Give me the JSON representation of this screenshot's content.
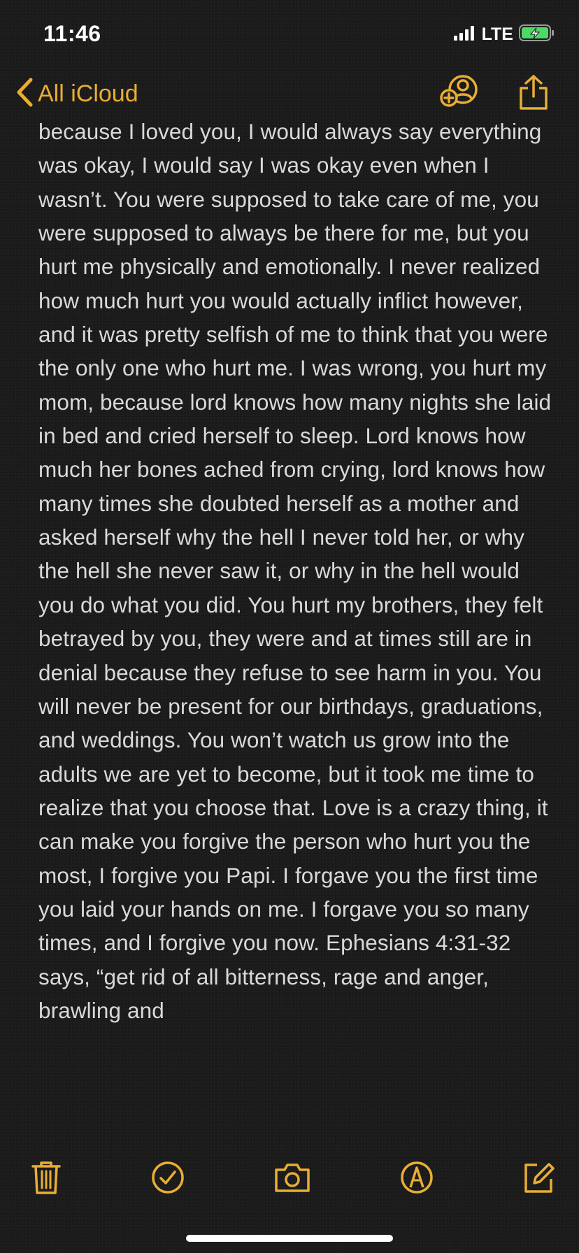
{
  "status_bar": {
    "time": "11:46",
    "carrier": "LTE",
    "icons": [
      "signal-bars-icon",
      "battery-charging-icon"
    ]
  },
  "nav": {
    "back_label": "All iCloud",
    "icons": [
      "chevron-left-icon",
      "add-people-icon",
      "share-icon"
    ]
  },
  "note": {
    "text": "because I loved you, I would always say everything was okay, I would say I was okay even when I wasn’t. You were supposed to take care of me, you were supposed to always be there for me, but you hurt me physically and emotionally. I never realized how much hurt you would actually inflict however, and it was pretty selfish of me to think that you were the only one who hurt me. I was wrong, you hurt my mom, because lord knows how many nights she laid in bed and cried herself to sleep. Lord knows how much her bones ached from crying, lord knows how many times she doubted herself as a mother and asked herself why the hell I never told her, or why the hell she never saw it, or why in the hell would you do what you did. You hurt my brothers, they felt betrayed by you, they were and at times still are in denial because they refuse to see harm in you. You will never be present for our birthdays, graduations, and weddings. You won’t watch us grow into the adults we are yet to become, but it took me time to realize that you choose that. Love is a crazy thing, it can make you forgive the person who hurt you the most, I forgive you Papi. I forgave you the first time you laid your hands on me. I forgave you so many times, and I forgive you now. Ephesians 4:31-32 says, “get rid of all bitterness, rage and anger, brawling and"
  },
  "toolbar": {
    "icons": [
      "trash-icon",
      "checklist-icon",
      "camera-icon",
      "markup-pen-icon",
      "compose-icon"
    ]
  },
  "colors": {
    "accent": "#e8ae34",
    "background": "#1c1c1c",
    "text": "#d9d9d9",
    "battery_green": "#4cd964"
  }
}
